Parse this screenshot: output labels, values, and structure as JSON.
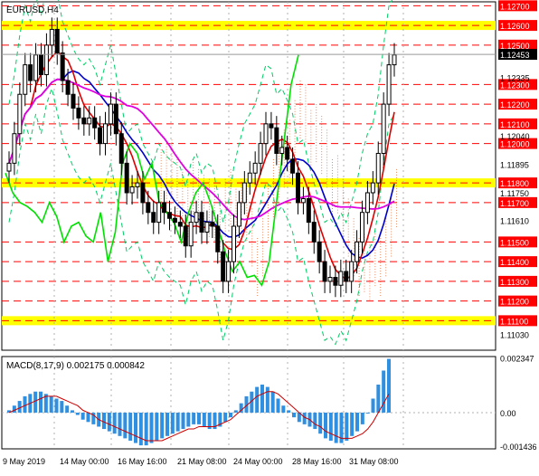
{
  "symbol_title": "EURUSD,H4",
  "macd_title": "MACD(8,17,9) 0.002175 0.000842",
  "colors": {
    "background": "#ffffff",
    "candle": "#000000",
    "level_line": "#ff0000",
    "highlight_band": "#ffff00",
    "red_axis_badge": "#ff0000",
    "line_green": "#00e000",
    "line_blue": "#0000cc",
    "line_red": "#dd0000",
    "line_magenta": "#e000e0",
    "bollinger": "#00cc66",
    "cloud": "#e05a1a",
    "macd_hist": "#2f8fe0",
    "macd_signal": "#cc0000"
  },
  "chart_data": [
    {
      "type": "candlestick",
      "title": "EURUSD,H4",
      "xlabel": "",
      "ylabel": "",
      "x_tick_labels": [
        "9 May 2019",
        "14 May 00:00",
        "16 May 16:00",
        "21 May 08:00",
        "24 May 00:00",
        "28 May 16:00",
        "31 May 08:00"
      ],
      "ylim": [
        1.1095,
        1.1272
      ],
      "horizontal_levels": [
        1.127,
        1.126,
        1.125,
        1.123,
        1.122,
        1.121,
        1.12,
        1.118,
        1.117,
        1.115,
        1.114,
        1.113,
        1.112,
        1.111
      ],
      "highlighted_levels": [
        1.126,
        1.118,
        1.111
      ],
      "axis_labels_highlighted": [
        "1.12700",
        "1.12600",
        "1.12500",
        "1.12300",
        "1.12200",
        "1.12100",
        "1.12000",
        "1.11800",
        "1.11700",
        "1.11500",
        "1.11400",
        "1.11300",
        "1.11200",
        "1.11100"
      ],
      "axis_labels_plain": [
        "1.12335",
        "1.12040",
        "1.11895",
        "1.11750",
        "1.11610",
        "1.11030"
      ],
      "current_price_label": "1.12453",
      "current_price": 1.12453,
      "series": [
        {
          "name": "",
          "kind": "close",
          "values": [
            1.119,
            1.1205,
            1.1225,
            1.124,
            1.1232,
            1.1245,
            1.1235,
            1.125,
            1.1258,
            1.1246,
            1.1232,
            1.1225,
            1.1218,
            1.1213,
            1.121,
            1.1213,
            1.1208,
            1.12,
            1.121,
            1.122,
            1.1205,
            1.119,
            1.1175,
            1.1178,
            1.118,
            1.117,
            1.1165,
            1.116,
            1.117,
            1.1165,
            1.1162,
            1.116,
            1.1158,
            1.1148,
            1.116,
            1.1165,
            1.1155,
            1.116,
            1.1158,
            1.1145,
            1.113,
            1.114,
            1.1158,
            1.117,
            1.118,
            1.1185,
            1.119,
            1.12,
            1.121,
            1.1208,
            1.1195,
            1.1198,
            1.1192,
            1.1185,
            1.117,
            1.1172,
            1.116,
            1.115,
            1.114,
            1.113,
            1.1132,
            1.1128,
            1.1135,
            1.113,
            1.114,
            1.115,
            1.1165,
            1.1175,
            1.118,
            1.1195,
            1.122,
            1.124,
            1.1245
          ]
        },
        {
          "name": "",
          "kind": "line_green",
          "values": [
            1.1185,
            1.1175,
            1.117,
            1.1168,
            1.1165,
            1.116,
            1.117,
            1.1163,
            1.115,
            1.1158,
            1.116,
            1.1153,
            1.115,
            1.1165,
            1.114,
            1.1155,
            1.119,
            1.12,
            1.1195,
            1.1182,
            1.119,
            1.117,
            1.1165,
            1.116,
            1.115,
            1.1165,
            1.1175,
            1.118,
            1.117,
            1.1158,
            1.1145,
            1.1135,
            1.114,
            1.1132,
            1.1133,
            1.1128,
            1.114,
            1.117,
            1.12,
            1.123,
            1.1245
          ]
        }
      ]
    },
    {
      "type": "bar",
      "title": "MACD(8,17,9) 0.002175 0.000842",
      "xlabel": "",
      "ylabel": "",
      "ylim": [
        -0.00155,
        0.0024
      ],
      "axis_labels": [
        "0.002347",
        "0.00",
        "-0.001436"
      ],
      "series": [
        {
          "name": "",
          "kind": "histogram",
          "values": [
            0.0001,
            0.0003,
            0.0005,
            0.0007,
            0.0008,
            0.0009,
            0.0009,
            0.0008,
            0.0007,
            0.0006,
            0.0005,
            0.0003,
            0.0001,
            -0.0001,
            -0.0003,
            -0.0004,
            -0.0005,
            -0.0006,
            -0.0007,
            -0.0008,
            -0.0009,
            -0.001,
            -0.0011,
            -0.0012,
            -0.0013,
            -0.0014,
            -0.0014,
            -0.0013,
            -0.0012,
            -0.0011,
            -0.001,
            -0.0009,
            -0.0008,
            -0.0007,
            -0.0006,
            -0.0005,
            -0.0005,
            -0.0006,
            -0.0007,
            -0.0007,
            -0.0006,
            -0.0004,
            -0.0002,
            0.0001,
            0.0004,
            0.0007,
            0.0009,
            0.0011,
            0.0012,
            0.0011,
            0.0009,
            0.0006,
            0.0003,
            0.0001,
            -0.0002,
            -0.0004,
            -0.0005,
            -0.0006,
            -0.0007,
            -0.0009,
            -0.0011,
            -0.0012,
            -0.0013,
            -0.0013,
            -0.0012,
            -0.001,
            -0.0008,
            -0.0005,
            0.0,
            0.0006,
            0.0012,
            0.0018,
            0.0023
          ]
        },
        {
          "name": "",
          "kind": "signal",
          "values": [
            0.0,
            0.0001,
            0.0002,
            0.0003,
            0.0004,
            0.0005,
            0.0006,
            0.0007,
            0.0007,
            0.0007,
            0.0006,
            0.0005,
            0.0004,
            0.0003,
            0.0001,
            0.0,
            -0.0001,
            -0.0003,
            -0.0004,
            -0.0005,
            -0.0006,
            -0.0007,
            -0.0008,
            -0.0009,
            -0.001,
            -0.0011,
            -0.0012,
            -0.0012,
            -0.0012,
            -0.0012,
            -0.0011,
            -0.001,
            -0.0009,
            -0.0008,
            -0.0007,
            -0.0007,
            -0.0006,
            -0.0006,
            -0.0006,
            -0.0006,
            -0.0005,
            -0.0004,
            -0.0003,
            -0.0001,
            0.0001,
            0.0003,
            0.0005,
            0.0007,
            0.0008,
            0.0009,
            0.0009,
            0.0008,
            0.0006,
            0.0004,
            0.0002,
            0.0,
            -0.0002,
            -0.0003,
            -0.0005,
            -0.0006,
            -0.0008,
            -0.0009,
            -0.001,
            -0.0011,
            -0.0011,
            -0.0011,
            -0.001,
            -0.0009,
            -0.0007,
            -0.0004,
            0.0,
            0.0004,
            0.0008
          ]
        }
      ]
    }
  ]
}
